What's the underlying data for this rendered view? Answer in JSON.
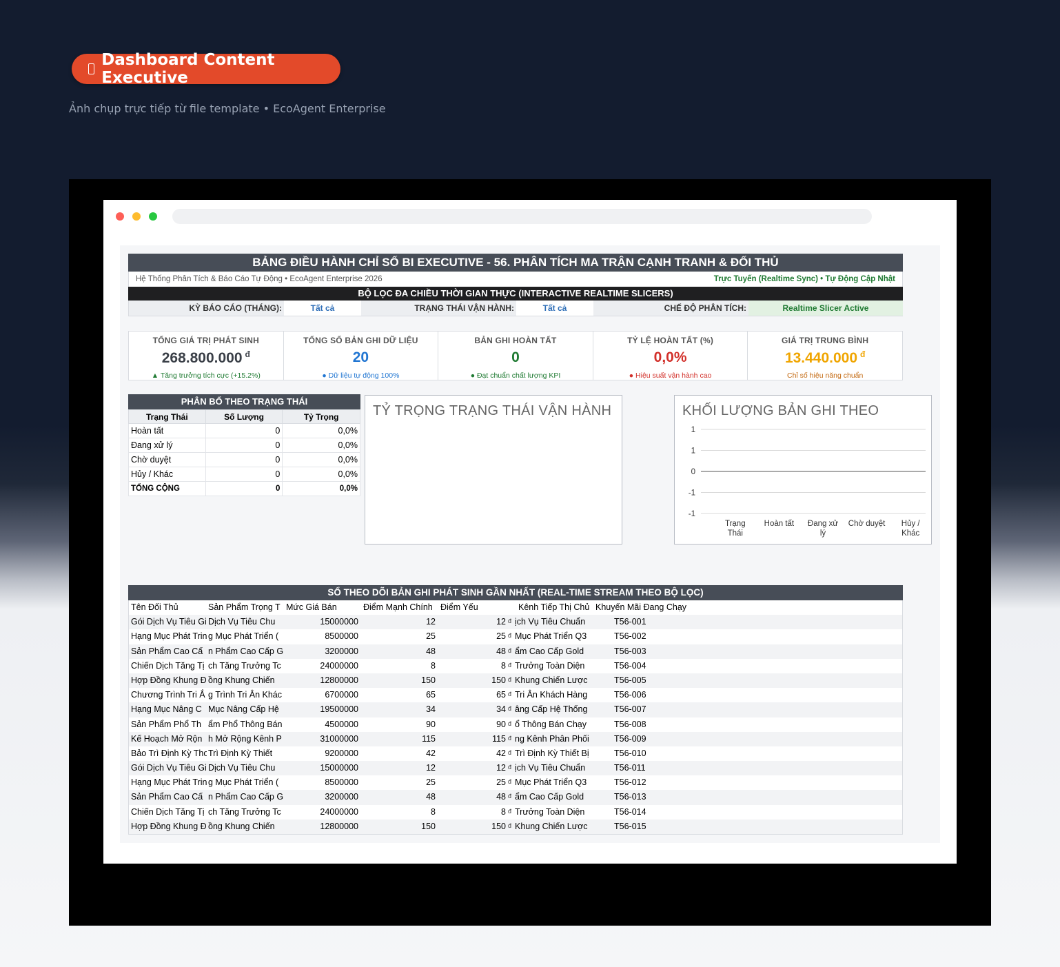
{
  "hero": {
    "badge": "Dashboard Content Executive",
    "subtitle": "Ảnh chụp trực tiếp từ file template • EcoAgent Enterprise"
  },
  "window": {
    "dots": [
      "#fe5f57",
      "#febc2e",
      "#28c840"
    ]
  },
  "sheet": {
    "title": "BẢNG ĐIỀU HÀNH CHỈ SỐ BI EXECUTIVE - 56. PHÂN TÍCH MA TRẬN CẠNH TRANH & ĐỐI THỦ",
    "info_left": "Hệ Thống Phân Tích & Báo Cáo Tự Động • EcoAgent Enterprise 2026",
    "info_right": "Trực Tuyến (Realtime Sync) • Tự Động Cập Nhật",
    "slicer_title": "BỘ LỌC ĐA CHIỀU THỜI GIAN THỰC (INTERACTIVE REALTIME SLICERS)",
    "slicers": {
      "period_label": "KỲ BÁO CÁO (THÁNG):",
      "period_value": "Tất cả",
      "status_label": "TRẠNG THÁI VẬN HÀNH:",
      "status_value": "Tất cả",
      "mode_label": "CHẾ ĐỘ PHÂN TÍCH:",
      "mode_value": "Realtime Slicer Active"
    },
    "kpis": [
      {
        "label": "TỔNG GIÁ TRỊ PHÁT SINH",
        "value": "268.800.000",
        "unit": "đ",
        "note": "▲ Tăng trưởng tích cực (+15.2%)",
        "color": "#3a3f47",
        "note_color": "#1f7a32"
      },
      {
        "label": "TỔNG SỐ BẢN GHI DỮ LIỆU",
        "value": "20",
        "unit": "",
        "note": "● Dữ liệu tự động 100%",
        "color": "#2176d2",
        "note_color": "#2176d2"
      },
      {
        "label": "BẢN GHI HOÀN TẤT",
        "value": "0",
        "unit": "",
        "note": "● Đạt chuẩn chất lượng KPI",
        "color": "#1f7a32",
        "note_color": "#1f7a32"
      },
      {
        "label": "TỶ LỆ HOÀN TẤT (%)",
        "value": "0,0%",
        "unit": "",
        "note": "● Hiệu suất vận hành cao",
        "color": "#d2302a",
        "note_color": "#d2302a"
      },
      {
        "label": "GIÁ TRỊ TRUNG BÌNH",
        "value": "13.440.000",
        "unit": "đ",
        "note": "Chỉ số hiệu năng chuẩn",
        "color": "#f0a500",
        "note_color": "#c46a12"
      }
    ],
    "distribution": {
      "title": "PHÂN BỔ THEO TRẠNG THÁI",
      "headers": [
        "Trạng Thái",
        "Số Lượng",
        "Tỷ Trọng"
      ],
      "rows": [
        [
          "Hoàn tất",
          "0",
          "0,0%"
        ],
        [
          "Đang xử lý",
          "0",
          "0,0%"
        ],
        [
          "Chờ duyệt",
          "0",
          "0,0%"
        ],
        [
          "Hủy / Khác",
          "0",
          "0,0%"
        ]
      ],
      "total": [
        "TỔNG CỘNG",
        "0",
        "0,0%"
      ]
    },
    "pie_panel": {
      "title": "TỶ TRỌNG TRẠNG THÁI VẬN HÀNH"
    },
    "stream": {
      "title": "SỔ THEO DÕI BẢN GHI PHÁT SINH GẦN NHẤT (REAL-TIME STREAM THEO BỘ LỌC)",
      "headers": [
        "Tên Đối Thủ",
        "Sản Phẩm Trọng T",
        "Mức Giá Bán",
        "Điểm Mạnh Chính",
        "Điểm Yếu",
        "Kênh Tiếp Thị Chủ",
        "Khuyến Mãi Đang Chạy"
      ],
      "rows": [
        [
          "Gói Dịch Vụ Tiêu Gi",
          "Dịch Vụ Tiêu Chu",
          "15000000",
          "12",
          "12",
          "đ",
          "ịch Vụ Tiêu Chuẩn",
          "T56-001"
        ],
        [
          "Hạng Mục Phát Trin",
          "g Mục Phát Triển (",
          "8500000",
          "25",
          "25",
          "đ",
          "Mục Phát Triển Q3",
          "T56-002"
        ],
        [
          "Sản Phẩm Cao Cấ",
          "n Phẩm Cao Cấp G",
          "3200000",
          "48",
          "48",
          "đ",
          "ẩm Cao Cấp Gold",
          "T56-003"
        ],
        [
          "Chiến Dịch Tăng Tị",
          "ch Tăng Trưởng Tc",
          "24000000",
          "8",
          "8",
          "đ",
          "Trưởng Toàn Diện",
          "T56-004"
        ],
        [
          "Hợp Đồng Khung Đ",
          "ồng Khung Chiến",
          "12800000",
          "150",
          "150",
          "đ",
          "Khung Chiến Lược",
          "T56-005"
        ],
        [
          "Chương Trình Tri Ắ",
          "g Trình Tri Ân Khác",
          "6700000",
          "65",
          "65",
          "đ",
          "Tri Ân Khách Hàng",
          "T56-006"
        ],
        [
          "Hạng Mục Nâng C",
          "Mục Nâng Cấp Hệ",
          "19500000",
          "34",
          "34",
          "đ",
          "âng Cấp Hệ Thống",
          "T56-007"
        ],
        [
          "Sản Phẩm Phổ Th",
          "ẩm Phổ Thông Bán",
          "4500000",
          "90",
          "90",
          "đ",
          "ổ Thông Bán Chạy",
          "T56-008"
        ],
        [
          "Kế Hoạch Mở Rộn",
          "h Mở Rộng Kênh P",
          "31000000",
          "115",
          "115",
          "đ",
          "ng Kênh Phân Phối",
          "T56-009"
        ],
        [
          "Bảo Trì Định Kỳ Tho",
          "Trì Định Kỳ Thiết",
          "9200000",
          "42",
          "42",
          "đ",
          "Trì Định Kỳ Thiết Bị",
          "T56-010"
        ],
        [
          "Gói Dịch Vụ Tiêu Gi",
          "Dịch Vụ Tiêu Chu",
          "15000000",
          "12",
          "12",
          "đ",
          "ịch Vụ Tiêu Chuẩn",
          "T56-011"
        ],
        [
          "Hạng Mục Phát Trin",
          "g Mục Phát Triển (",
          "8500000",
          "25",
          "25",
          "đ",
          "Mục Phát Triển Q3",
          "T56-012"
        ],
        [
          "Sản Phẩm Cao Cấ",
          "n Phẩm Cao Cấp G",
          "3200000",
          "48",
          "48",
          "đ",
          "ẩm Cao Cấp Gold",
          "T56-013"
        ],
        [
          "Chiến Dịch Tăng Tị",
          "ch Tăng Trưởng Tc",
          "24000000",
          "8",
          "8",
          "đ",
          "Trưởng Toàn Diện",
          "T56-014"
        ],
        [
          "Hợp Đồng Khung Đ",
          "ồng Khung Chiến",
          "12800000",
          "150",
          "150",
          "đ",
          "Khung Chiến Lược",
          "T56-015"
        ]
      ]
    }
  },
  "chart_data": {
    "type": "bar",
    "title": "KHỐI LƯỢNG BẢN GHI THEO",
    "categories": [
      "Trạng Thái",
      "Hoàn tất",
      "Đang xử lý",
      "Chờ duyệt",
      "Hủy / Khác"
    ],
    "values": [
      0,
      0,
      0,
      0,
      0
    ],
    "y_ticks": [
      "1",
      "1",
      "0",
      "-1",
      "-1"
    ],
    "ylim": [
      -1,
      1
    ],
    "grid": true,
    "legend": "none"
  }
}
